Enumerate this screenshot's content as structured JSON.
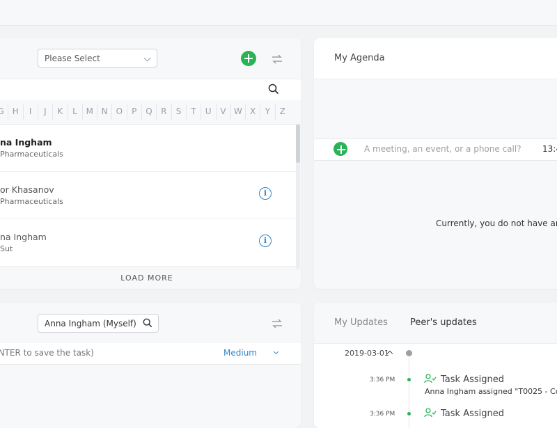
{
  "contacts": {
    "filter": {
      "placeholder": "Please Select"
    },
    "alphabet": [
      "G",
      "H",
      "I",
      "J",
      "K",
      "L",
      "M",
      "N",
      "O",
      "P",
      "Q",
      "R",
      "S",
      "T",
      "U",
      "V",
      "W",
      "X",
      "Y",
      "Z"
    ],
    "items": [
      {
        "name": "na Ingham",
        "company": "Pharmaceuticals"
      },
      {
        "name": "or Khasanov",
        "company": "Pharmaceuticals"
      },
      {
        "name": "na Ingham",
        "company": "Sut"
      }
    ],
    "load_more": "LOAD MORE"
  },
  "agenda": {
    "title": "My Agenda",
    "input_placeholder": "A meeting, an event, or a phone call?",
    "time": "13:4",
    "empty_message": "Currently, you do not have any"
  },
  "tasks": {
    "assignee": "Anna Ingham (Myself)",
    "input_hint": "ENTER to save the task)",
    "priority": "Medium"
  },
  "updates": {
    "tabs": [
      "My Updates",
      "Peer's updates"
    ],
    "date": "2019-03-01",
    "entries": [
      {
        "time": "3:36 PM",
        "title": "Task Assigned",
        "desc": "Anna Ingham assigned \"T0025 - Cod"
      },
      {
        "time": "3:36 PM",
        "title": "Task Assigned",
        "desc": ""
      }
    ]
  },
  "colors": {
    "accent_green": "#2ab356",
    "accent_blue": "#2f86c8"
  }
}
